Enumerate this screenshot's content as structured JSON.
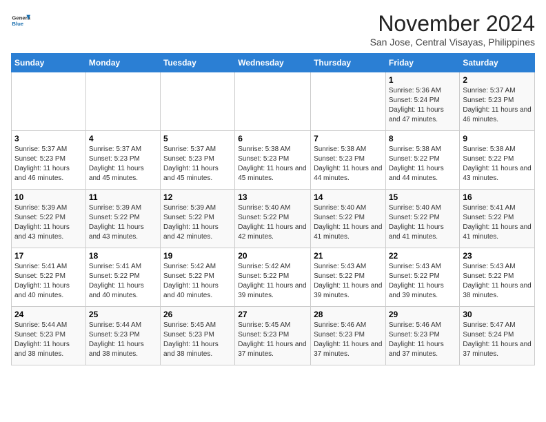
{
  "header": {
    "logo_general": "General",
    "logo_blue": "Blue",
    "title": "November 2024",
    "subtitle": "San Jose, Central Visayas, Philippines"
  },
  "calendar": {
    "days_of_week": [
      "Sunday",
      "Monday",
      "Tuesday",
      "Wednesday",
      "Thursday",
      "Friday",
      "Saturday"
    ],
    "weeks": [
      [
        {
          "day": "",
          "info": ""
        },
        {
          "day": "",
          "info": ""
        },
        {
          "day": "",
          "info": ""
        },
        {
          "day": "",
          "info": ""
        },
        {
          "day": "",
          "info": ""
        },
        {
          "day": "1",
          "info": "Sunrise: 5:36 AM\nSunset: 5:24 PM\nDaylight: 11 hours and 47 minutes."
        },
        {
          "day": "2",
          "info": "Sunrise: 5:37 AM\nSunset: 5:23 PM\nDaylight: 11 hours and 46 minutes."
        }
      ],
      [
        {
          "day": "3",
          "info": "Sunrise: 5:37 AM\nSunset: 5:23 PM\nDaylight: 11 hours and 46 minutes."
        },
        {
          "day": "4",
          "info": "Sunrise: 5:37 AM\nSunset: 5:23 PM\nDaylight: 11 hours and 45 minutes."
        },
        {
          "day": "5",
          "info": "Sunrise: 5:37 AM\nSunset: 5:23 PM\nDaylight: 11 hours and 45 minutes."
        },
        {
          "day": "6",
          "info": "Sunrise: 5:38 AM\nSunset: 5:23 PM\nDaylight: 11 hours and 45 minutes."
        },
        {
          "day": "7",
          "info": "Sunrise: 5:38 AM\nSunset: 5:23 PM\nDaylight: 11 hours and 44 minutes."
        },
        {
          "day": "8",
          "info": "Sunrise: 5:38 AM\nSunset: 5:22 PM\nDaylight: 11 hours and 44 minutes."
        },
        {
          "day": "9",
          "info": "Sunrise: 5:38 AM\nSunset: 5:22 PM\nDaylight: 11 hours and 43 minutes."
        }
      ],
      [
        {
          "day": "10",
          "info": "Sunrise: 5:39 AM\nSunset: 5:22 PM\nDaylight: 11 hours and 43 minutes."
        },
        {
          "day": "11",
          "info": "Sunrise: 5:39 AM\nSunset: 5:22 PM\nDaylight: 11 hours and 43 minutes."
        },
        {
          "day": "12",
          "info": "Sunrise: 5:39 AM\nSunset: 5:22 PM\nDaylight: 11 hours and 42 minutes."
        },
        {
          "day": "13",
          "info": "Sunrise: 5:40 AM\nSunset: 5:22 PM\nDaylight: 11 hours and 42 minutes."
        },
        {
          "day": "14",
          "info": "Sunrise: 5:40 AM\nSunset: 5:22 PM\nDaylight: 11 hours and 41 minutes."
        },
        {
          "day": "15",
          "info": "Sunrise: 5:40 AM\nSunset: 5:22 PM\nDaylight: 11 hours and 41 minutes."
        },
        {
          "day": "16",
          "info": "Sunrise: 5:41 AM\nSunset: 5:22 PM\nDaylight: 11 hours and 41 minutes."
        }
      ],
      [
        {
          "day": "17",
          "info": "Sunrise: 5:41 AM\nSunset: 5:22 PM\nDaylight: 11 hours and 40 minutes."
        },
        {
          "day": "18",
          "info": "Sunrise: 5:41 AM\nSunset: 5:22 PM\nDaylight: 11 hours and 40 minutes."
        },
        {
          "day": "19",
          "info": "Sunrise: 5:42 AM\nSunset: 5:22 PM\nDaylight: 11 hours and 40 minutes."
        },
        {
          "day": "20",
          "info": "Sunrise: 5:42 AM\nSunset: 5:22 PM\nDaylight: 11 hours and 39 minutes."
        },
        {
          "day": "21",
          "info": "Sunrise: 5:43 AM\nSunset: 5:22 PM\nDaylight: 11 hours and 39 minutes."
        },
        {
          "day": "22",
          "info": "Sunrise: 5:43 AM\nSunset: 5:22 PM\nDaylight: 11 hours and 39 minutes."
        },
        {
          "day": "23",
          "info": "Sunrise: 5:43 AM\nSunset: 5:22 PM\nDaylight: 11 hours and 38 minutes."
        }
      ],
      [
        {
          "day": "24",
          "info": "Sunrise: 5:44 AM\nSunset: 5:23 PM\nDaylight: 11 hours and 38 minutes."
        },
        {
          "day": "25",
          "info": "Sunrise: 5:44 AM\nSunset: 5:23 PM\nDaylight: 11 hours and 38 minutes."
        },
        {
          "day": "26",
          "info": "Sunrise: 5:45 AM\nSunset: 5:23 PM\nDaylight: 11 hours and 38 minutes."
        },
        {
          "day": "27",
          "info": "Sunrise: 5:45 AM\nSunset: 5:23 PM\nDaylight: 11 hours and 37 minutes."
        },
        {
          "day": "28",
          "info": "Sunrise: 5:46 AM\nSunset: 5:23 PM\nDaylight: 11 hours and 37 minutes."
        },
        {
          "day": "29",
          "info": "Sunrise: 5:46 AM\nSunset: 5:23 PM\nDaylight: 11 hours and 37 minutes."
        },
        {
          "day": "30",
          "info": "Sunrise: 5:47 AM\nSunset: 5:24 PM\nDaylight: 11 hours and 37 minutes."
        }
      ]
    ]
  }
}
